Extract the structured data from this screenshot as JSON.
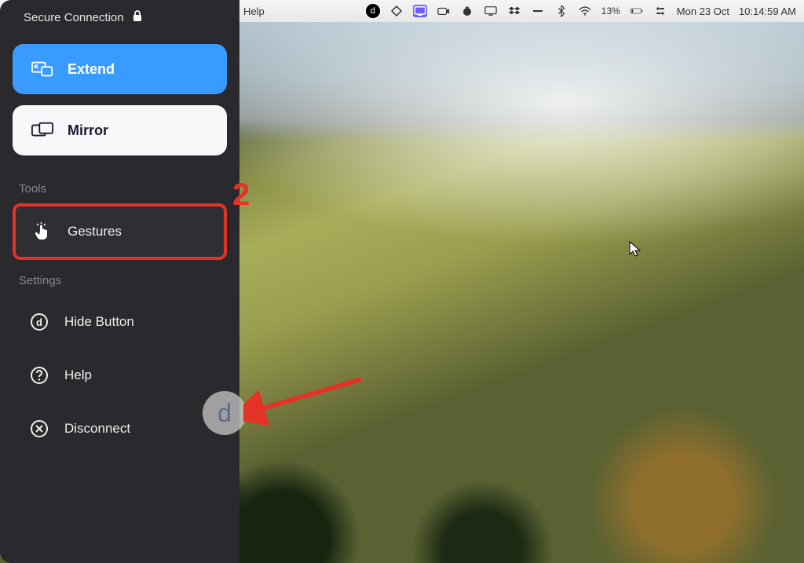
{
  "menubar": {
    "help": "Help",
    "battery": "13%",
    "date": "Mon 23 Oct",
    "time": "10:14:59 AM"
  },
  "sidebar": {
    "title": "Secure Connection",
    "modes": {
      "extend": "Extend",
      "mirror": "Mirror"
    },
    "tools_label": "Tools",
    "tools": {
      "gestures": "Gestures"
    },
    "settings_label": "Settings",
    "settings": {
      "hide_button": "Hide Button",
      "help": "Help",
      "disconnect": "Disconnect"
    }
  },
  "annotations": {
    "step_number": "2"
  },
  "floating": {
    "d_label": "d"
  }
}
